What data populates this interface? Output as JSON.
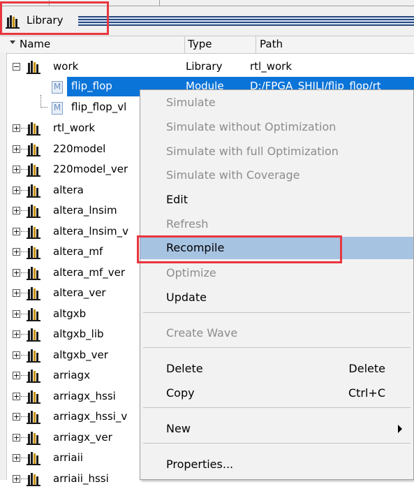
{
  "pane": {
    "title": "Library"
  },
  "columns": {
    "name": "Name",
    "type": "Type",
    "path": "Path"
  },
  "tree": {
    "work": {
      "name": "work",
      "type": "Library",
      "path": "rtl_work"
    },
    "selected": {
      "name": "flip_flop",
      "type": "Module",
      "path": "D:/FPGA_SHILI/flip_flop/rt"
    },
    "child2": {
      "name": "flip_flop_vl"
    },
    "libraries": [
      "rtl_work",
      "220model",
      "220model_ver",
      "altera",
      "altera_lnsim",
      "altera_lnsim_v",
      "altera_mf",
      "altera_mf_ver",
      "altera_ver",
      "altgxb",
      "altgxb_lib",
      "altgxb_ver",
      "arriagx",
      "arriagx_hssi",
      "arriagx_hssi_v",
      "arriagx_ver",
      "arriaii",
      "arriaii_hssi"
    ]
  },
  "context_menu": {
    "simulate": "Simulate",
    "simulate_no_opt": "Simulate without Optimization",
    "simulate_full_opt": "Simulate with full Optimization",
    "simulate_cov": "Simulate with Coverage",
    "edit": "Edit",
    "refresh": "Refresh",
    "recompile": "Recompile",
    "optimize": "Optimize",
    "update": "Update",
    "create_wave": "Create Wave",
    "delete": "Delete",
    "delete_key": "Delete",
    "copy": "Copy",
    "copy_key": "Ctrl+C",
    "new": "New",
    "properties": "Properties..."
  },
  "colors": {
    "selection": "#0b74d9",
    "menu_highlight": "#a7c3e2",
    "annotation": "#e8363f"
  },
  "icons": {
    "library": "library-books-icon",
    "module": "module-file-icon"
  }
}
